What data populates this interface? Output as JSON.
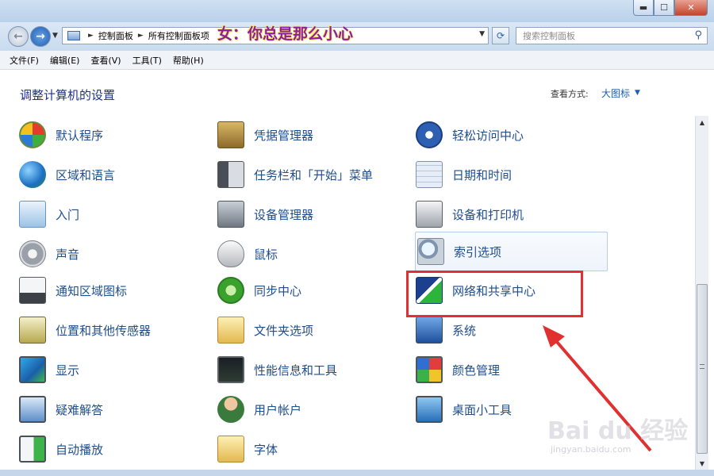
{
  "window": {
    "minimize_label": "▬",
    "maximize_label": "☐",
    "close_label": "✕"
  },
  "nav": {
    "back_glyph": "←",
    "forward_glyph": "→"
  },
  "address": {
    "segments": [
      "控制面板",
      "所有控制面板项"
    ],
    "separator": "►"
  },
  "search": {
    "placeholder": "搜索控制面板"
  },
  "overlay_caption": "女：你总是那么小心",
  "menubar": {
    "items": [
      "文件(F)",
      "编辑(E)",
      "查看(V)",
      "工具(T)",
      "帮助(H)"
    ]
  },
  "header": {
    "title": "调整计算机的设置",
    "view_label": "查看方式:",
    "view_value": "大图标"
  },
  "items": [
    {
      "label": "默认程序",
      "icon": "default-programs-icon"
    },
    {
      "label": "凭据管理器",
      "icon": "credential-manager-icon"
    },
    {
      "label": "轻松访问中心",
      "icon": "ease-of-access-icon"
    },
    {
      "label": "区域和语言",
      "icon": "region-language-icon"
    },
    {
      "label": "任务栏和「开始」菜单",
      "icon": "taskbar-icon"
    },
    {
      "label": "日期和时间",
      "icon": "date-time-icon"
    },
    {
      "label": "入门",
      "icon": "getting-started-icon"
    },
    {
      "label": "设备管理器",
      "icon": "device-manager-icon"
    },
    {
      "label": "设备和打印机",
      "icon": "devices-printers-icon"
    },
    {
      "label": "声音",
      "icon": "sound-icon"
    },
    {
      "label": "鼠标",
      "icon": "mouse-icon"
    },
    {
      "label": "索引选项",
      "icon": "indexing-options-icon"
    },
    {
      "label": "通知区域图标",
      "icon": "notification-area-icon"
    },
    {
      "label": "同步中心",
      "icon": "sync-center-icon"
    },
    {
      "label": "网络和共享中心",
      "icon": "network-sharing-icon"
    },
    {
      "label": "位置和其他传感器",
      "icon": "location-sensors-icon"
    },
    {
      "label": "文件夹选项",
      "icon": "folder-options-icon"
    },
    {
      "label": "系统",
      "icon": "system-icon"
    },
    {
      "label": "显示",
      "icon": "display-icon"
    },
    {
      "label": "性能信息和工具",
      "icon": "performance-icon"
    },
    {
      "label": "颜色管理",
      "icon": "color-management-icon"
    },
    {
      "label": "疑难解答",
      "icon": "troubleshooting-icon"
    },
    {
      "label": "用户帐户",
      "icon": "user-accounts-icon"
    },
    {
      "label": "桌面小工具",
      "icon": "desktop-gadgets-icon"
    },
    {
      "label": "自动播放",
      "icon": "autoplay-icon"
    },
    {
      "label": "字体",
      "icon": "fonts-icon"
    }
  ],
  "watermark": {
    "brand": "Bai du 经验",
    "url": "jingyan.baidu.com"
  },
  "colors": {
    "link": "#1e4e8c",
    "title": "#1e3287",
    "annotation": "#e0302f"
  }
}
